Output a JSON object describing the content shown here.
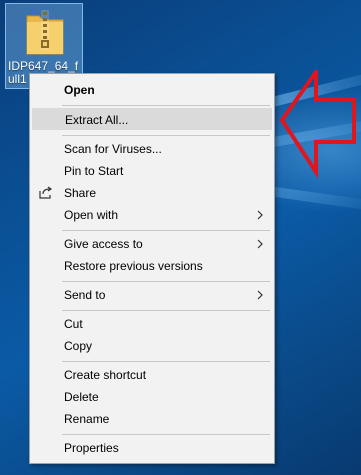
{
  "desktop": {
    "file": {
      "name": "IDP647_64_full1",
      "icon": "zip-folder-icon"
    }
  },
  "annotation": {
    "arrow_color": "#e0151e",
    "icon": "red-arrow-icon"
  },
  "context_menu": {
    "items": [
      {
        "label": "Open"
      },
      {
        "label": "Extract All..."
      },
      {
        "label": "Scan for Viruses..."
      },
      {
        "label": "Pin to Start"
      },
      {
        "label": "Share",
        "icon": "share-icon"
      },
      {
        "label": "Open with",
        "submenu_icon": "chevron-right-icon"
      },
      {
        "label": "Give access to",
        "submenu_icon": "chevron-right-icon"
      },
      {
        "label": "Restore previous versions"
      },
      {
        "label": "Send to",
        "submenu_icon": "chevron-right-icon"
      },
      {
        "label": "Cut"
      },
      {
        "label": "Copy"
      },
      {
        "label": "Create shortcut"
      },
      {
        "label": "Delete"
      },
      {
        "label": "Rename"
      },
      {
        "label": "Properties"
      }
    ],
    "highlighted": "Extract All...",
    "default_item": "Open"
  }
}
